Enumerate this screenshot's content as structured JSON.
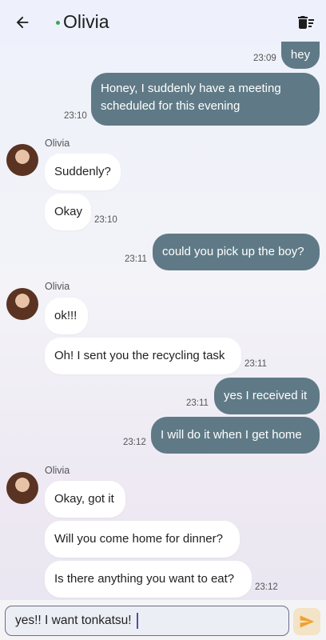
{
  "header": {
    "back_icon": "arrow-left-icon",
    "title": "Olivia",
    "status_color": "#3aa55a",
    "delete_icon": "delete-sweep-icon"
  },
  "messages": [
    {
      "side": "out",
      "text": "hey",
      "time": "23:09"
    },
    {
      "side": "out",
      "text": "Honey, I suddenly have a meeting scheduled for this evening",
      "time": "23:10"
    },
    {
      "sender": "Olivia",
      "side": "in",
      "text": "Suddenly?"
    },
    {
      "side": "in",
      "text": "Okay",
      "time": "23:10"
    },
    {
      "side": "out",
      "text": "could you pick up the boy?",
      "time": "23:11"
    },
    {
      "sender": "Olivia",
      "side": "in",
      "text": "ok!!!"
    },
    {
      "side": "in",
      "text": "Oh! I sent you the recycling task",
      "time": "23:11"
    },
    {
      "side": "out",
      "text": "yes I received it",
      "time": "23:11"
    },
    {
      "side": "out",
      "text": "I will do it when I get home",
      "time": "23:12"
    },
    {
      "sender": "Olivia",
      "side": "in",
      "text": "Okay, got it"
    },
    {
      "side": "in",
      "text": "Will you come home for dinner?"
    },
    {
      "side": "in",
      "text": "Is there anything you want to eat?",
      "time": "23:12"
    }
  ],
  "composer": {
    "value": "yes!! I want tonkatsu!",
    "send_icon": "send-icon"
  },
  "colors": {
    "outgoing_bubble": "#5f7a86",
    "incoming_bubble": "#ffffff",
    "send_accent": "#f0a030"
  }
}
